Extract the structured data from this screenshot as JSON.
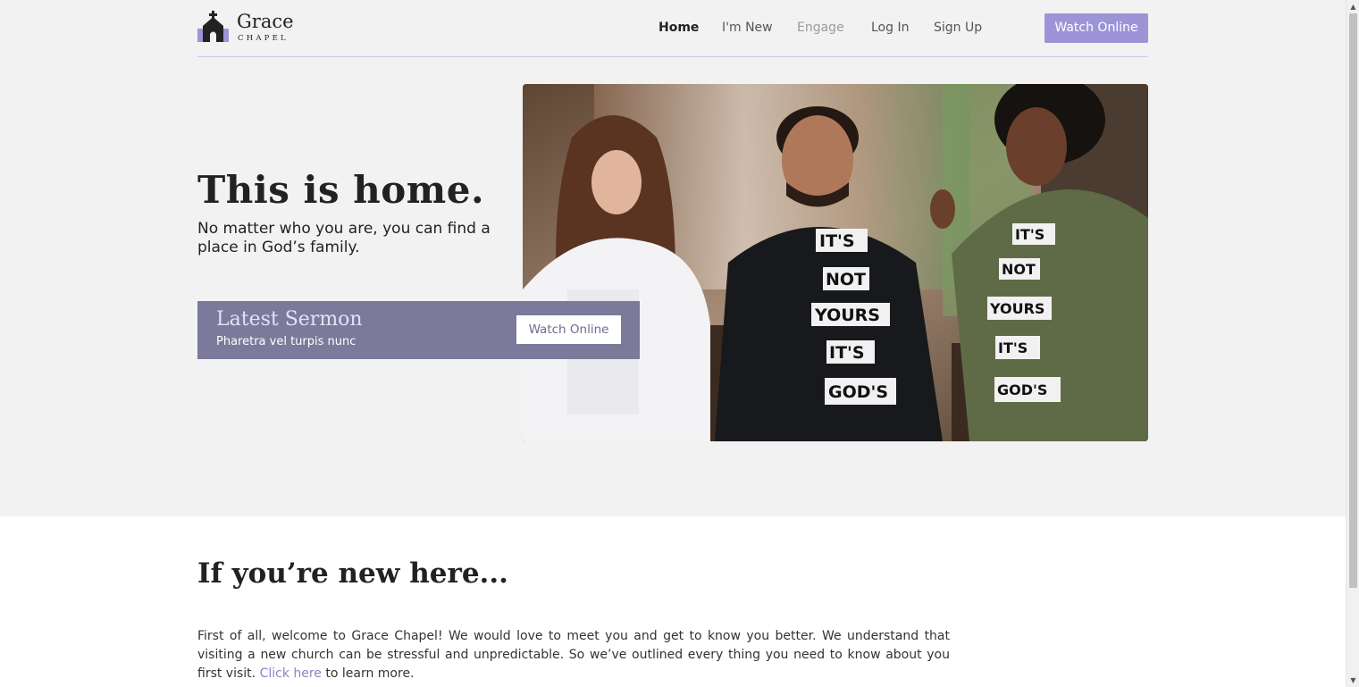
{
  "brand": {
    "name": "Grace",
    "tagline": "CHAPEL",
    "accent_color": "#9d94d8",
    "icon": "church-icon"
  },
  "nav": {
    "items": [
      {
        "label": "Home",
        "state": "active"
      },
      {
        "label": "I'm New",
        "state": "normal"
      },
      {
        "label": "Engage",
        "state": "muted"
      },
      {
        "label": "Log In",
        "state": "normal"
      },
      {
        "label": "Sign Up",
        "state": "normal"
      }
    ],
    "cta": "Watch Online"
  },
  "hero": {
    "title": "This is home.",
    "subtitle": "No matter who you are, you can find a place in God’s family.",
    "image": "hero-photo",
    "shirt_lines": [
      "IT'S",
      "NOT",
      "YOURS",
      "IT'S",
      "GOD'S"
    ]
  },
  "sermon": {
    "title": "Latest Sermon",
    "subtitle": "Pharetra vel turpis nunc",
    "button": "Watch Online",
    "panel_color": "#7b7a9b"
  },
  "new_here": {
    "title": "If you’re new here...",
    "body": "First of all, welcome to Grace Chapel! We would love to meet you and get to know you better. We understand that visiting a new church can be stressful and unpredictable. So we’ve outlined every thing you need to know about you first visit.",
    "link": "Click here",
    "link_tail": " to learn more."
  }
}
